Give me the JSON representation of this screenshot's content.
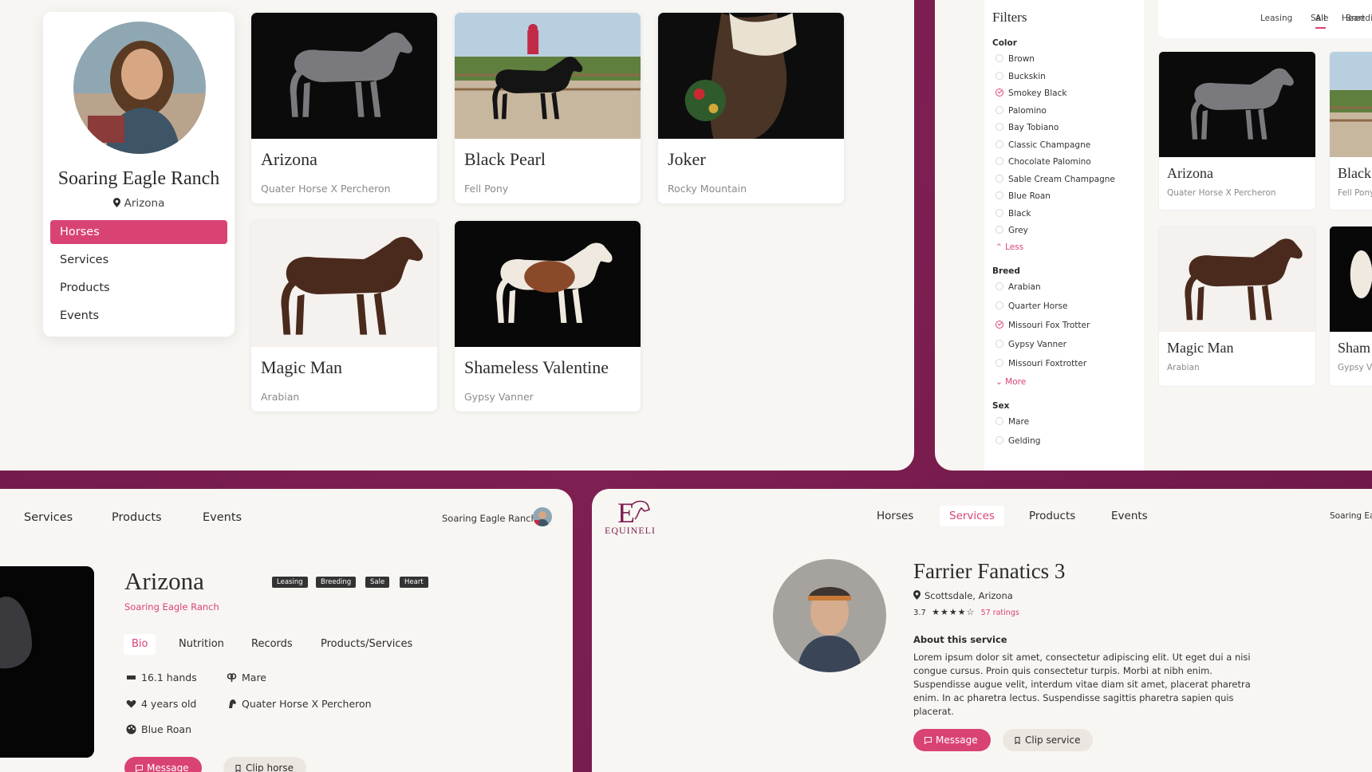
{
  "profile": {
    "name": "Soaring Eagle Ranch",
    "location": "Arizona",
    "nav": [
      {
        "label": "Horses",
        "active": true
      },
      {
        "label": "Services",
        "active": false
      },
      {
        "label": "Products",
        "active": false
      },
      {
        "label": "Events",
        "active": false
      }
    ]
  },
  "horses": [
    {
      "name": "Arizona",
      "breed": "Quater Horse X Percheron"
    },
    {
      "name": "Black Pearl",
      "breed": "Fell Pony"
    },
    {
      "name": "Joker",
      "breed": "Rocky Mountain"
    },
    {
      "name": "Magic Man",
      "breed": "Arabian"
    },
    {
      "name": "Shameless Valentine",
      "breed": "Gypsy Vanner"
    }
  ],
  "filters": {
    "title": "Filters",
    "color": {
      "label": "Color",
      "options": [
        "Brown",
        "Buckskin",
        "Smokey Black",
        "Palomino",
        "Bay Tobiano",
        "Classic Champagne",
        "Chocolate Palomino",
        "Sable Cream Champagne",
        "Blue Roan",
        "Black",
        "Grey"
      ],
      "checked": "Smokey Black",
      "toggle": "Less"
    },
    "breed": {
      "label": "Breed",
      "options": [
        "Arabian",
        "Quarter Horse",
        "Missouri Fox Trotter",
        "Gypsy Vanner",
        "Missouri Foxtrotter"
      ],
      "checked": "Missouri Fox Trotter",
      "toggle": "More"
    },
    "sex": {
      "label": "Sex",
      "options": [
        "Mare",
        "Gelding"
      ]
    }
  },
  "listing_tabs": [
    "All",
    "Breeding",
    "Leasing",
    "Sale",
    "Heart"
  ],
  "listing_cards": [
    {
      "name": "Arizona",
      "breed": "Quater Horse X Percheron"
    },
    {
      "name": "Black",
      "breed": "Fell Pony"
    },
    {
      "name": "Magic Man",
      "breed": "Arabian"
    },
    {
      "name": "Sham",
      "breed": "Gypsy V"
    }
  ],
  "horse_detail": {
    "nav": [
      "Services",
      "Products",
      "Events"
    ],
    "ranch": "Soaring Eagle Ranch",
    "name": "Arizona",
    "owner": "Soaring Eagle Ranch",
    "tags": [
      "Leasing",
      "Breeding",
      "Sale",
      "Heart"
    ],
    "tabs": [
      "Bio",
      "Nutrition",
      "Records",
      "Products/Services"
    ],
    "active_tab": "Bio",
    "facts": {
      "height": "16.1 hands",
      "sex": "Mare",
      "age": "4 years old",
      "breed": "Quater Horse X Percheron",
      "color": "Blue Roan"
    },
    "message_label": "Message",
    "clip_label": "Clip horse"
  },
  "service_detail": {
    "logo_text": "EQUINELI",
    "nav": [
      "Horses",
      "Services",
      "Products",
      "Events"
    ],
    "active_nav": "Services",
    "ranch": "Soaring Eag",
    "name": "Farrier Fanatics 3",
    "location": "Scottsdale, Arizona",
    "rating": "3.7",
    "rating_value": 3.7,
    "rating_count": "57 ratings",
    "about_title": "About this service",
    "description": "Lorem ipsum dolor sit amet, consectetur adipiscing elit. Ut eget dui a nisi congue cursus. Proin quis consectetur turpis. Morbi at nibh enim. Suspendisse augue velit, interdum vitae diam sit amet, placerat pharetra enim. In ac pharetra lectus. Suspendisse sagittis pharetra sapien quis placerat.",
    "message_label": "Message",
    "clip_label": "Clip service"
  },
  "colors": {
    "accent": "#d94374",
    "frame": "#7e1f52",
    "panel": "#f8f6f3"
  }
}
